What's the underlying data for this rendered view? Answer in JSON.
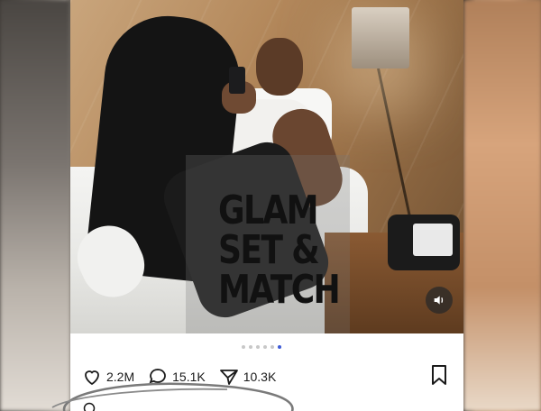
{
  "photo": {
    "watermark_lines": [
      "GLAM",
      "SET &",
      "MATCH"
    ],
    "sound_icon": "speaker-icon"
  },
  "carousel": {
    "dot_count": 6,
    "active_index": 5,
    "active_color": "#3e5bd6"
  },
  "actions": {
    "likes": "2.2M",
    "comments": "15.1K",
    "shares": "10.3K",
    "like_icon": "heart-icon",
    "comment_icon": "comment-bubble-icon",
    "share_icon": "send-icon",
    "bookmark_icon": "bookmark-icon"
  },
  "annotation": {
    "scribble_color": "#7a7a7a"
  }
}
